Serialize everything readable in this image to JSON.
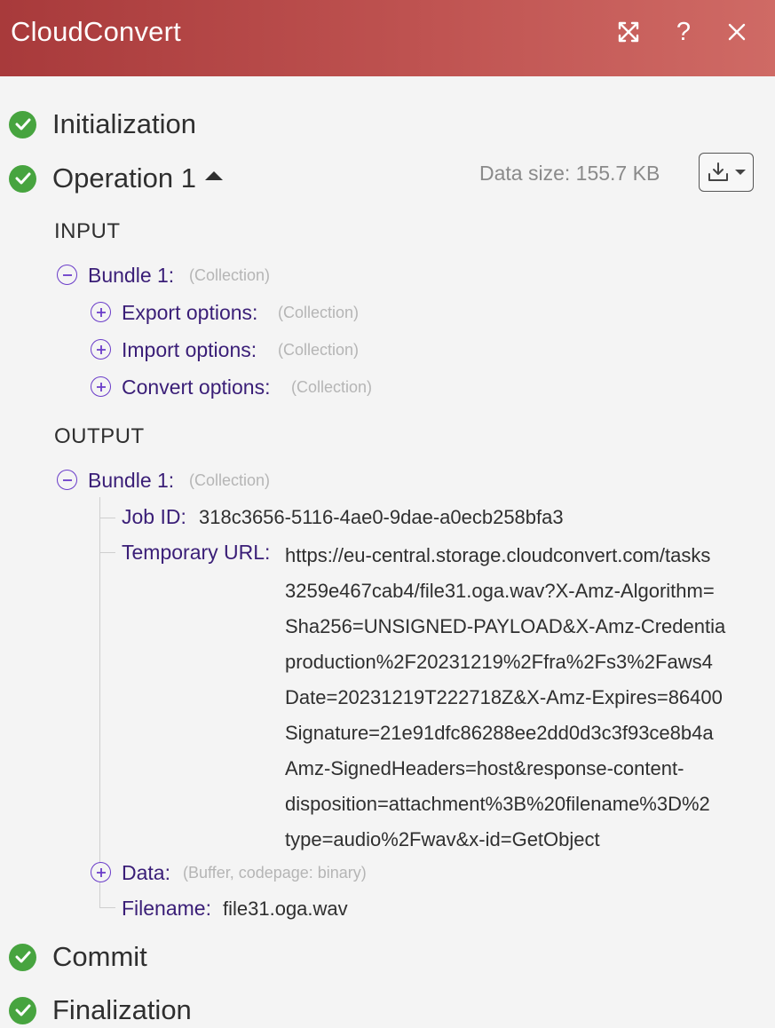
{
  "header": {
    "title": "CloudConvert",
    "icons": [
      "expand-icon",
      "help-icon",
      "close-icon"
    ],
    "help_label": "?"
  },
  "steps": {
    "initialization": "Initialization",
    "operation": "Operation 1",
    "commit": "Commit",
    "finalization": "Finalization"
  },
  "data_size": "Data size: 155.7 KB",
  "input": {
    "section_label": "INPUT",
    "bundle": {
      "label": "Bundle 1:",
      "type": "(Collection)"
    },
    "items": [
      {
        "label": "Export options:",
        "type": "(Collection)"
      },
      {
        "label": "Import options:",
        "type": "(Collection)"
      },
      {
        "label": "Convert options:",
        "type": "(Collection)"
      }
    ]
  },
  "output": {
    "section_label": "OUTPUT",
    "bundle": {
      "label": "Bundle 1:",
      "type": "(Collection)"
    },
    "job_id": {
      "label": "Job ID:",
      "value": "318c3656-5116-4ae0-9dae-a0ecb258bfa3"
    },
    "temporary_url": {
      "label": "Temporary URL:",
      "lines": [
        "https://eu-central.storage.cloudconvert.com/tasks",
        "3259e467cab4/file31.oga.wav?X-Amz-Algorithm=",
        "Sha256=UNSIGNED-PAYLOAD&X-Amz-Credentia",
        "production%2F20231219%2Ffra%2Fs3%2Faws4",
        "Date=20231219T222718Z&X-Amz-Expires=86400",
        "Signature=21e91dfc86288ee2dd0d3c3f93ce8b4a",
        "Amz-SignedHeaders=host&response-content-",
        "disposition=attachment%3B%20filename%3D%2",
        "type=audio%2Fwav&x-id=GetObject"
      ]
    },
    "data": {
      "label": "Data:",
      "type": "(Buffer, codepage: binary)"
    },
    "filename": {
      "label": "Filename:",
      "value": "file31.oga.wav"
    }
  },
  "colors": {
    "header_start": "#a83a3b",
    "header_end": "#cf6a65",
    "success": "#47a43f",
    "key_text": "#3a1e77",
    "toggle": "#6a3cc9"
  }
}
